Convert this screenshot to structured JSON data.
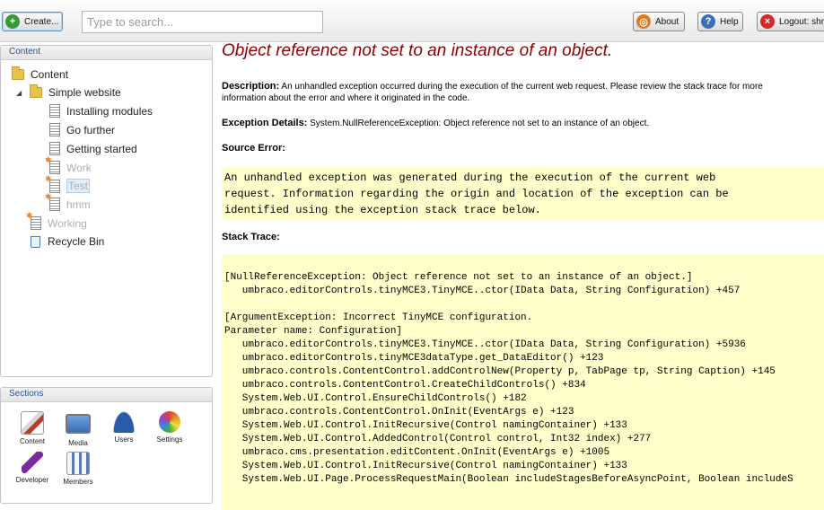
{
  "toolbar": {
    "create_label": "Create...",
    "search_placeholder": "Type to search...",
    "about_label": "About",
    "help_label": "Help",
    "logout_label": "Logout: shr"
  },
  "content_panel": {
    "title": "Content",
    "tree": [
      {
        "label": "Content",
        "type": "folder",
        "published": true
      },
      {
        "label": "Simple website",
        "type": "folder",
        "published": true
      },
      {
        "label": "Installing modules",
        "type": "doc",
        "published": true
      },
      {
        "label": "Go further",
        "type": "doc",
        "published": true
      },
      {
        "label": "Getting started",
        "type": "doc",
        "published": true
      },
      {
        "label": "Work",
        "type": "doc",
        "published": false
      },
      {
        "label": "Test",
        "type": "doc",
        "published": false,
        "selected": true
      },
      {
        "label": "hmm",
        "type": "doc",
        "published": false
      },
      {
        "label": "Working",
        "type": "doc",
        "published": false
      },
      {
        "label": "Recycle Bin",
        "type": "bin",
        "published": true
      }
    ]
  },
  "sections_panel": {
    "title": "Sections",
    "items": [
      {
        "label": "Content",
        "icon": "content-icon",
        "color": "#c0392b"
      },
      {
        "label": "Media",
        "icon": "media-icon",
        "color": "#3b6fb6"
      },
      {
        "label": "Users",
        "icon": "users-icon",
        "color": "#2a5aa8"
      },
      {
        "label": "Settings",
        "icon": "settings-icon",
        "color": "#e0a020"
      },
      {
        "label": "Developer",
        "icon": "developer-icon",
        "color": "#7a2a9a"
      },
      {
        "label": "Members",
        "icon": "members-icon",
        "color": "#5a7ab0"
      }
    ]
  },
  "error": {
    "title": "Object reference not set to an instance of an object.",
    "description_label": "Description:",
    "description_text": "An unhandled exception occurred during the execution of the current web request. Please review the stack trace for more",
    "description_text2": "information about the error and where it originated in the code.",
    "details_label": "Exception Details:",
    "details_text": "System.NullReferenceException: Object reference not set to an instance of an object.",
    "source_label": "Source Error:",
    "source_lines": [
      "An unhandled exception was generated during the execution of the current web",
      "request. Information regarding the origin and location of the exception can be",
      "identified using the exception stack trace below."
    ],
    "stack_label": "Stack Trace:",
    "stack_lines": [
      "[NullReferenceException: Object reference not set to an instance of an object.]",
      "   umbraco.editorControls.tinyMCE3.TinyMCE..ctor(IData Data, String Configuration) +457",
      "",
      "[ArgumentException: Incorrect TinyMCE configuration.",
      "Parameter name: Configuration]",
      "   umbraco.editorControls.tinyMCE3.TinyMCE..ctor(IData Data, String Configuration) +5936",
      "   umbraco.editorControls.tinyMCE3dataType.get_DataEditor() +123",
      "   umbraco.controls.ContentControl.addControlNew(Property p, TabPage tp, String Caption) +145",
      "   umbraco.controls.ContentControl.CreateChildControls() +834",
      "   System.Web.UI.Control.EnsureChildControls() +182",
      "   umbraco.controls.ContentControl.OnInit(EventArgs e) +123",
      "   System.Web.UI.Control.InitRecursive(Control namingContainer) +133",
      "   System.Web.UI.Control.AddedControl(Control control, Int32 index) +277",
      "   umbraco.cms.presentation.editContent.OnInit(EventArgs e) +1005",
      "   System.Web.UI.Control.InitRecursive(Control namingContainer) +133",
      "   System.Web.UI.Page.ProcessRequestMain(Boolean includeStagesBeforeAsyncPoint, Boolean includeS"
    ]
  }
}
